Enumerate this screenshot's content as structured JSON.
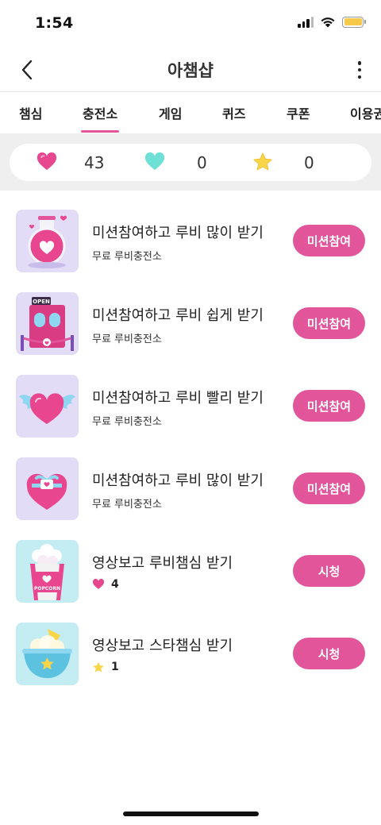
{
  "status_bar": {
    "time": "1:54"
  },
  "nav": {
    "title": "아챔샵"
  },
  "tabs": [
    {
      "label": "챔심"
    },
    {
      "label": "충전소",
      "active": true
    },
    {
      "label": "게임"
    },
    {
      "label": "퀴즈"
    },
    {
      "label": "쿠폰"
    },
    {
      "label": "이용권"
    }
  ],
  "summary": {
    "ruby_count": "43",
    "mint_heart_count": "0",
    "star_count": "0"
  },
  "missions": [
    {
      "title": "미션참여하고 루비 많이 받기",
      "subtitle": "무료 루비충전소",
      "button": "미션참여",
      "thumb": "potion-icon"
    },
    {
      "title": "미션참여하고 루비 쉽게 받기",
      "subtitle": "무료 루비충전소",
      "button": "미션참여",
      "thumb": "open-store-icon",
      "thumb_text": "OPEN"
    },
    {
      "title": "미션참여하고 루비 빨리 받기",
      "subtitle": "무료 루비충전소",
      "button": "미션참여",
      "thumb": "winged-heart-icon"
    },
    {
      "title": "미션참여하고 루비 많이 받기",
      "subtitle": "무료 루비충전소",
      "button": "미션참여",
      "thumb": "gift-heart-icon"
    },
    {
      "title": "영상보고 루비챔심 받기",
      "reward": "4",
      "reward_icon": "heart-icon",
      "button": "시청",
      "thumb": "popcorn-icon",
      "thumb_text": "POPCORN"
    },
    {
      "title": "영상보고 스타챔심 받기",
      "reward": "1",
      "reward_icon": "star-icon",
      "button": "시청",
      "thumb": "cereal-bowl-icon"
    }
  ],
  "colors": {
    "accent": "#e2559a",
    "thumb_purple": "#e3dcf7",
    "thumb_cyan": "#c3ecf3",
    "mint": "#6ee0d6",
    "star": "#f9d54a"
  }
}
